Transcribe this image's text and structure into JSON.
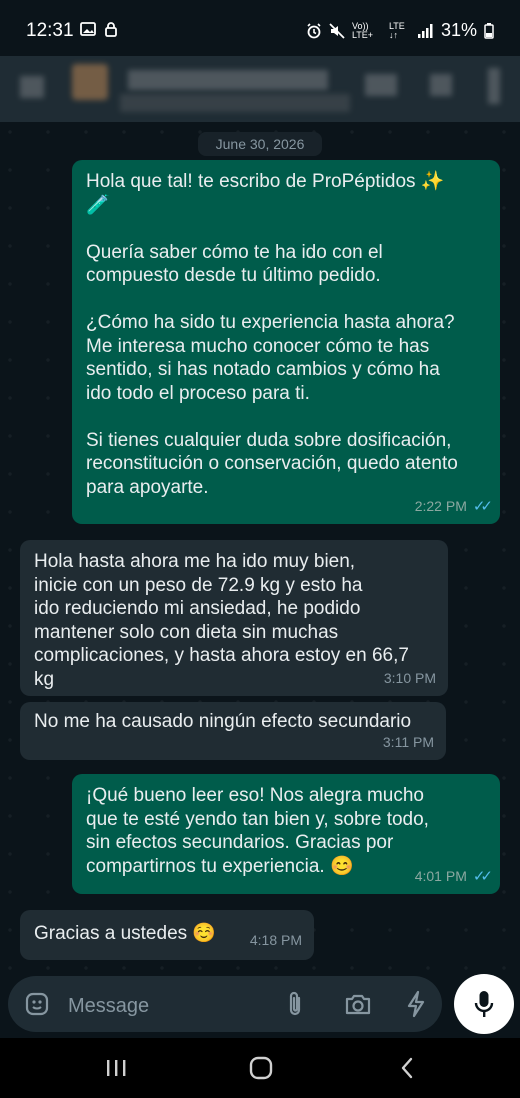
{
  "status_bar": {
    "time": "12:31",
    "volte": "Vo)) LTE+",
    "lte": "LTE ↓↑",
    "battery": "31%"
  },
  "chat": {
    "date_chip": "June 30, 2026",
    "messages": [
      {
        "direction": "outgoing",
        "text": "Hola que tal! te escribo de ProPéptidos ✨\n🧪\n\nQuería saber cómo te ha ido con el\ncompuesto desde tu último pedido.\n\n¿Cómo ha sido tu experiencia hasta ahora?\nMe interesa mucho conocer cómo te has\nsentido, si has notado cambios y cómo ha\nido todo el proceso para ti.\n\nSi tienes cualquier duda sobre dosificación,\nreconstitución o conservación, quedo atento\npara apoyarte.",
        "time": "2:22 PM",
        "read": true
      },
      {
        "direction": "incoming",
        "text": "Hola hasta ahora me ha ido muy bien,\ninicie con un peso de 72.9 kg y esto ha\nido reduciendo mi ansiedad, he podido\nmantener solo con dieta sin muchas\ncomplicaciones, y hasta ahora estoy en 66,7\nkg",
        "time": "3:10 PM"
      },
      {
        "direction": "incoming",
        "text": "No me ha causado ningún efecto secundario",
        "time": "3:11 PM"
      },
      {
        "direction": "outgoing",
        "text": "¡Qué bueno leer eso! Nos alegra mucho\nque te esté yendo tan bien y, sobre todo,\nsin efectos secundarios. Gracias por\ncompartirnos tu experiencia. 😊",
        "time": "4:01 PM",
        "read": true
      },
      {
        "direction": "incoming",
        "text": "Gracias a ustedes ☺️",
        "time": "4:18 PM"
      }
    ]
  },
  "composer": {
    "placeholder": "Message"
  },
  "colors": {
    "outgoing_bubble": "#005c4b",
    "incoming_bubble": "#202c33",
    "read_ticks": "#53bdeb",
    "background": "#0b141a"
  }
}
